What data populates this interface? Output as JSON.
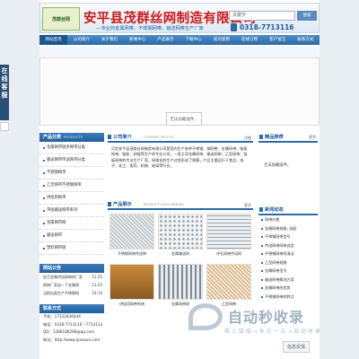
{
  "header": {
    "logo_text": "茂群丝网",
    "company_name": "安平县茂群丝网制造有限公司",
    "slogan": "---专业的金属网带、不锈钢网带、输送网带生产厂家",
    "search_placeholder": "关键字",
    "search_button": "搜索",
    "phone": "0318-7713116"
  },
  "nav": [
    "网站首页",
    "公司简介",
    "关于我们",
    "新闻中心",
    "产品展示",
    "下载中心",
    "成功案例",
    "在线订购",
    "客户留言",
    "联系方式"
  ],
  "banner": {
    "no_image": "无法加载插件。"
  },
  "float_tab": [
    "在",
    "线",
    "客",
    "服"
  ],
  "categories": {
    "title": "产品分类",
    "title_en": "PRODUCTS",
    "items": [
      "金属网带",
      "输送网带",
      "不锈钢网带",
      "链板",
      "烘干网带",
      "冷藏链网带",
      "输送网带",
      "金属网带",
      "乙型网带",
      "塑料网带"
    ],
    "displayed": [
      "金属网带链条网带分类",
      "输送网带传送网带分类",
      "不锈钢网带",
      "乙型网带不锈钢网带",
      "烘焙用网带",
      "平面输送网带系列",
      "金属网带网",
      "输送网带",
      "塑料网带链"
    ]
  },
  "news": {
    "title": "网站公告",
    "items": [
      {
        "text": "加工定做烘焙网带的厂家",
        "date": "11-25"
      },
      {
        "text": "网带厂家谈一下金属网",
        "date": "11-25"
      },
      {
        "text": "当前自身生产不锈钢网",
        "date": "10-14"
      }
    ]
  },
  "contact": {
    "title": "联系方式",
    "lines": [
      "手机：17331836444",
      "电话：0318-7713116 - 7713113",
      "QQ：1286186266@qq.com",
      "网址：http://www.lyaoxue.com"
    ]
  },
  "about": {
    "title": "公司简介",
    "title_en": "COMPANY PROFILE",
    "more": "详细",
    "text": "河北安平县茂群丝网制造有限公司是国内生产各种不锈钢、钢网带、金属网带、链板网带、链轮、网链等生产的专业公司。一直主导金属网带、输送网带、乙型网带、链板网带的专业生产厂家。网络化的生产过程形成了规模，产品主要运行于食品、电子、化工、医药、机械、玻璃等行业。"
  },
  "products": {
    "title": "产品展示",
    "title_en": "PRODUCTS RECOMMEND",
    "more": "更多",
    "items": [
      "不锈钢网带传送带",
      "金属输送网",
      "冲孔网带传动网",
      "烘焙用网带系统",
      "金属网带网",
      "乙型网带"
    ]
  },
  "recommend": {
    "title": "精品推荐",
    "more": "更多",
    "empty": "无法加载插件。"
  },
  "latest": {
    "title": "新闻动态",
    "items": [
      "网带价格",
      "金属网带规格, 选配",
      "不锈钢网带型号",
      "传送网带网带选型",
      "不锈钢网带的清洁",
      "乙型网带规格",
      "金属网带型号",
      "输送网带解决方案",
      "金属网带的优势",
      "不锈钢网带的特点"
    ]
  },
  "watermark": {
    "title": "自动秒收录",
    "sub": "做 上 链 接 → 来 访 一 次 → 自 动 收 录"
  },
  "feedback": "信息反馈"
}
